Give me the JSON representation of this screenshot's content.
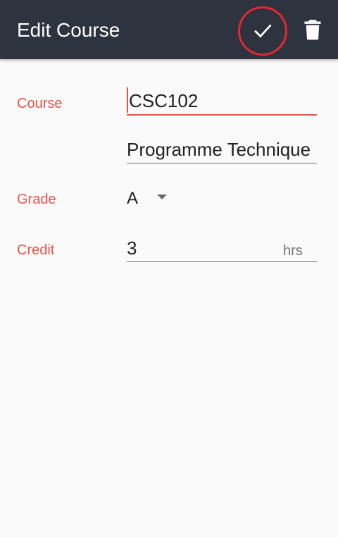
{
  "app_bar": {
    "title": "Edit Course",
    "save_icon": "check-icon",
    "delete_icon": "trash-icon",
    "background": "#2d3440",
    "highlight_color": "#e4282d"
  },
  "form": {
    "accent_color": "#e8534a",
    "course": {
      "label": "Course",
      "code_value": "CSC102",
      "name_value": "Programme Technique"
    },
    "grade": {
      "label": "Grade",
      "selected": "A"
    },
    "credit": {
      "label": "Credit",
      "value": "3",
      "suffix": "hrs"
    }
  }
}
